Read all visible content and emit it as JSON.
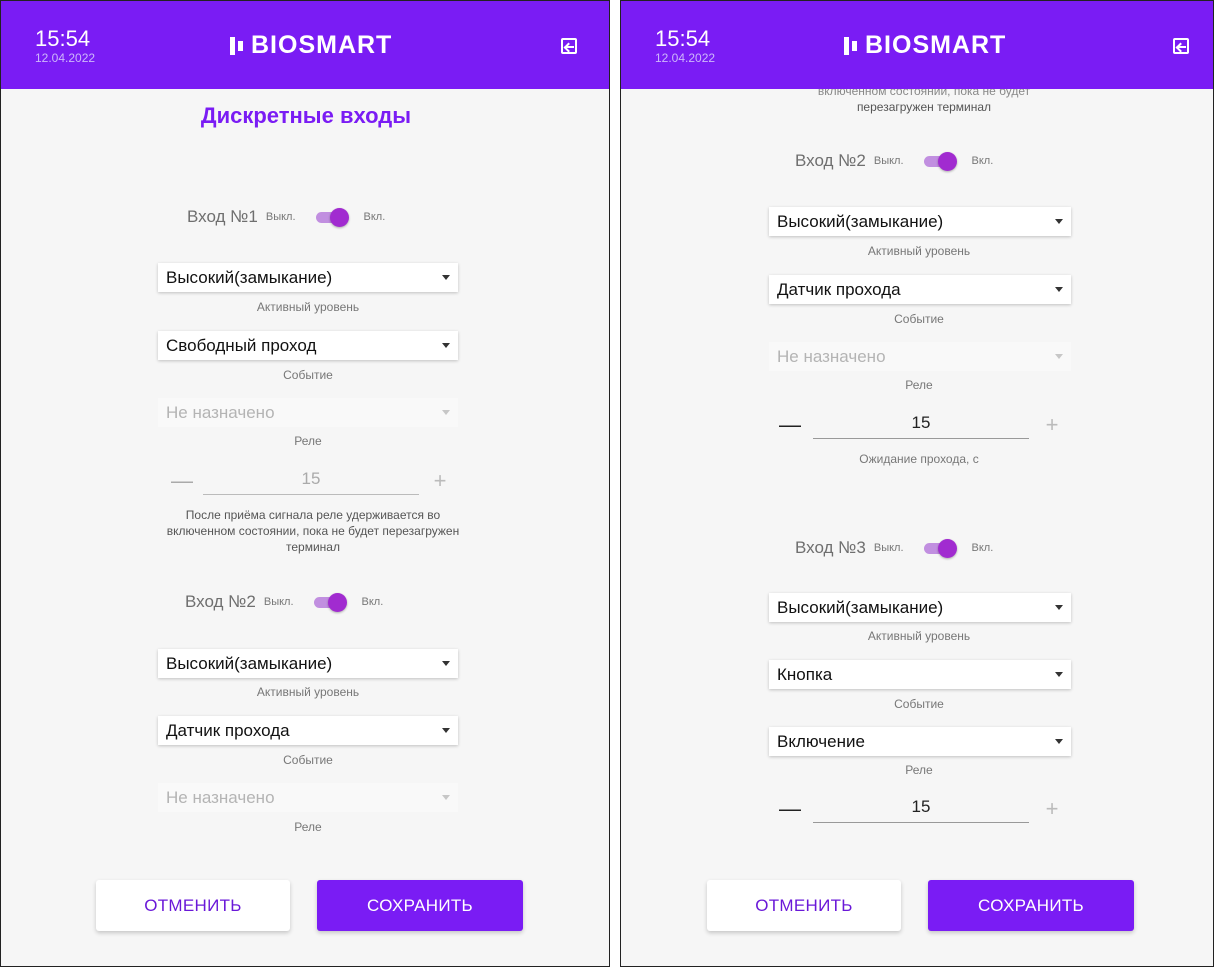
{
  "header": {
    "time": "15:54",
    "date": "12.04.2022",
    "logo": "BIOSMART",
    "exit_icon": "exit-icon"
  },
  "colors": {
    "accent": "#7a1cf4",
    "toggle": "#a12bd0",
    "background": "#f6f6f6"
  },
  "left": {
    "title": "Дискретные входы",
    "input1": {
      "label": "Вход №1",
      "off": "Выкл.",
      "on": "Вкл.",
      "enabled": true,
      "level": "Высокий(замыкание)",
      "level_caption": "Активный уровень",
      "event": "Свободный проход",
      "event_caption": "Событие",
      "relay": "Не назначено",
      "relay_caption": "Реле",
      "stepper_minus": "—",
      "stepper_value": "15",
      "stepper_plus": "+",
      "note": "После приёма сигнала реле удерживается во включенном состоянии, пока не будет перезагружен терминал"
    },
    "input2": {
      "label": "Вход №2",
      "off": "Выкл.",
      "on": "Вкл.",
      "enabled": true,
      "level": "Высокий(замыкание)",
      "level_caption": "Активный уровень",
      "event": "Датчик прохода",
      "event_caption": "Событие",
      "relay": "Не назначено",
      "relay_caption": "Реле"
    },
    "buttons": {
      "cancel": "ОТМЕНИТЬ",
      "save": "СОХРАНИТЬ"
    }
  },
  "right": {
    "note_tail_line1": "включенном состоянии, пока не будет",
    "note_tail_line2": "перезагружен терминал",
    "input2": {
      "label": "Вход №2",
      "off": "Выкл.",
      "on": "Вкл.",
      "enabled": true,
      "level": "Высокий(замыкание)",
      "level_caption": "Активный уровень",
      "event": "Датчик прохода",
      "event_caption": "Событие",
      "relay": "Не назначено",
      "relay_caption": "Реле",
      "stepper_minus": "—",
      "stepper_value": "15",
      "stepper_plus": "+",
      "stepper_caption": "Ожидание прохода, с"
    },
    "input3": {
      "label": "Вход №3",
      "off": "Выкл.",
      "on": "Вкл.",
      "enabled": true,
      "level": "Высокий(замыкание)",
      "level_caption": "Активный уровень",
      "event": "Кнопка",
      "event_caption": "Событие",
      "relay": "Включение",
      "relay_caption": "Реле",
      "stepper_minus": "—",
      "stepper_value": "15",
      "stepper_plus": "+"
    },
    "buttons": {
      "cancel": "ОТМЕНИТЬ",
      "save": "СОХРАНИТЬ"
    }
  }
}
